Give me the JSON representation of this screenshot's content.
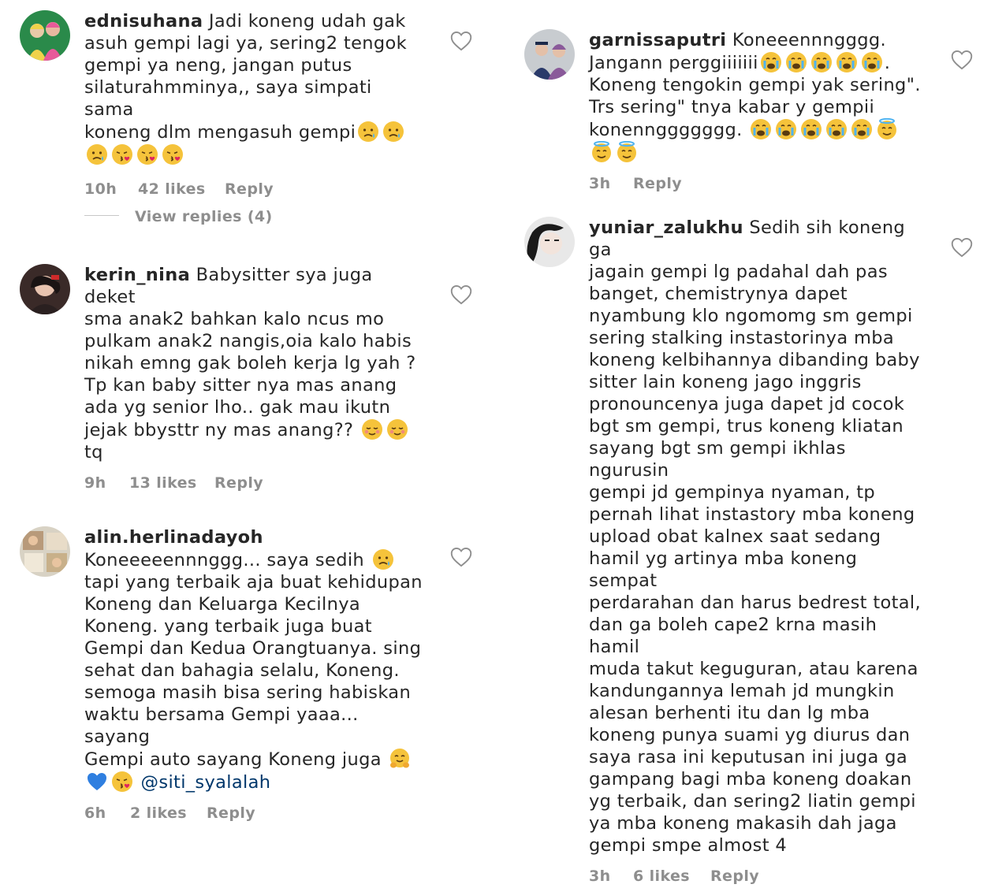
{
  "left": {
    "c1": {
      "username": "ednisuhana",
      "text_a": " Jadi koneng udah gak\nasuh  gempi lagi ya, sering2 tengok\ngempi ya neng, jangan putus\nsilaturahmminya,, saya simpati sama\nkoneng dlm mengasuh gempi",
      "time": "10h",
      "likes": "42 likes",
      "reply": "Reply"
    },
    "view_replies": "View replies (4)",
    "c2": {
      "username": "kerin_nina",
      "text_a": " Babysitter sya juga deket\nsma anak2 bahkan kalo ncus mo\npulkam anak2 nangis,oia kalo habis\nnikah emng gak boleh kerja lg yah ?\nTp kan baby sitter nya mas anang\nada yg senior lho.. gak mau ikutn\njejak bbysttr ny mas anang?? ",
      "text_b": "\ntq",
      "time": "9h",
      "likes": "13 likes",
      "reply": "Reply"
    },
    "c3": {
      "username": "alin.herlinadayoh",
      "text_a": "\nKoneeeeennnggg... saya sedih ",
      "text_b": "\ntapi yang terbaik aja buat kehidupan\nKoneng dan Keluarga Kecilnya\nKoneng. yang terbaik juga buat\nGempi dan Kedua Orangtuanya. sing\nsehat dan bahagia selalu, Koneng.\nsemoga masih bisa sering habiskan\nwaktu bersama Gempi yaaa... sayang\nGempi auto sayang Koneng juga ",
      "mention": "@siti_syalalah",
      "time": "6h",
      "likes": "2 likes",
      "reply": "Reply"
    }
  },
  "right": {
    "c4": {
      "username": "garnissaputri",
      "text_a": " Koneeennngggg.\nJangann perggiiiiiii",
      "text_b": ".\nKoneng tengokin gempi yak sering\".\nTrs sering\" tnya kabar y gempii\nkonennggggggg. ",
      "time": "3h",
      "reply": "Reply"
    },
    "c5": {
      "username": "yuniar_zalukhu",
      "text_a": " Sedih sih koneng ga\njagain gempi lg padahal dah pas\nbanget, chemistrynya dapet\nnyambung klo ngomomg sm gempi\nsering stalking instastorinya mba\nkoneng kelbihannya dibanding baby\nsitter lain koneng jago inggris\npronouncenya juga dapet jd cocok\nbgt sm gempi, trus koneng kliatan\nsayang bgt sm gempi ikhlas ngurusin\ngempi jd gempinya nyaman, tp\npernah lihat instastory mba koneng\nupload obat kalnex saat sedang\nhamil yg artinya mba koneng sempat\nperdarahan dan harus bedrest total,\ndan ga boleh cape2 krna masih hamil\nmuda takut keguguran, atau karena\nkandungannya lemah jd mungkin\nalesan berhenti itu dan lg mba\nkoneng punya suami yg diurus dan\nsaya rasa ini keputusan ini juga ga\ngampang bagi mba koneng doakan\nyg terbaik, dan sering2 liatin gempi\nya mba koneng makasih dah jaga\ngempi smpe almost 4",
      "time": "3h",
      "likes": "6 likes",
      "reply": "Reply"
    }
  },
  "colors": {
    "text": "#262626",
    "meta": "#8e8e8e",
    "mention": "#00376b",
    "emoji": "#f5c33b"
  }
}
